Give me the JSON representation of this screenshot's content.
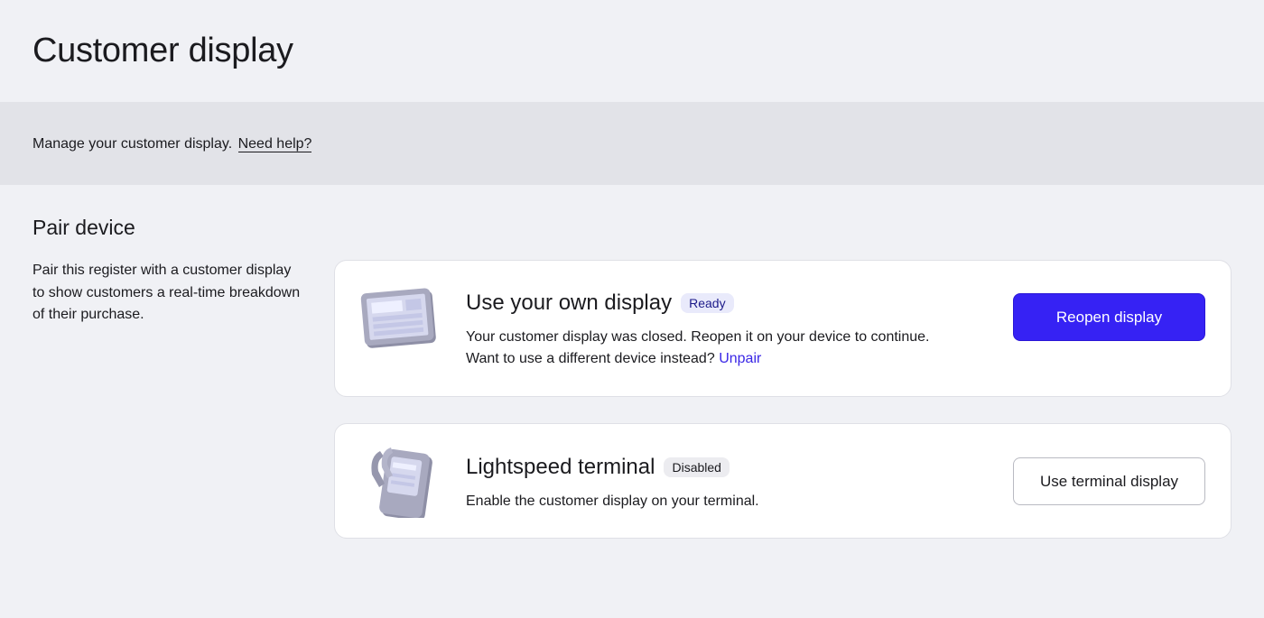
{
  "page": {
    "title": "Customer display"
  },
  "info_bar": {
    "text": "Manage your customer display.",
    "help_link": "Need help?"
  },
  "pair_section": {
    "title": "Pair device",
    "description": "Pair this register with a customer display to show customers a real-time breakdown of their purchase."
  },
  "own_display": {
    "icon": "tablet-icon",
    "title": "Use your own display",
    "badge": "Ready",
    "desc_line1": "Your customer display was closed. Reopen it on your device to continue.",
    "desc_line2": "Want to use a different device instead?",
    "unpair_link": "Unpair",
    "button": "Reopen display"
  },
  "terminal": {
    "icon": "payment-terminal-icon",
    "title": "Lightspeed terminal",
    "badge": "Disabled",
    "desc": "Enable the customer display on your terminal.",
    "button": "Use terminal display"
  },
  "colors": {
    "background": "#f0f1f5",
    "info_bar": "#e2e3e8",
    "primary_button": "#3622f4",
    "link": "#3a27e6",
    "ready_badge_bg": "#e9eafb",
    "disabled_badge_bg": "#ececf0"
  }
}
